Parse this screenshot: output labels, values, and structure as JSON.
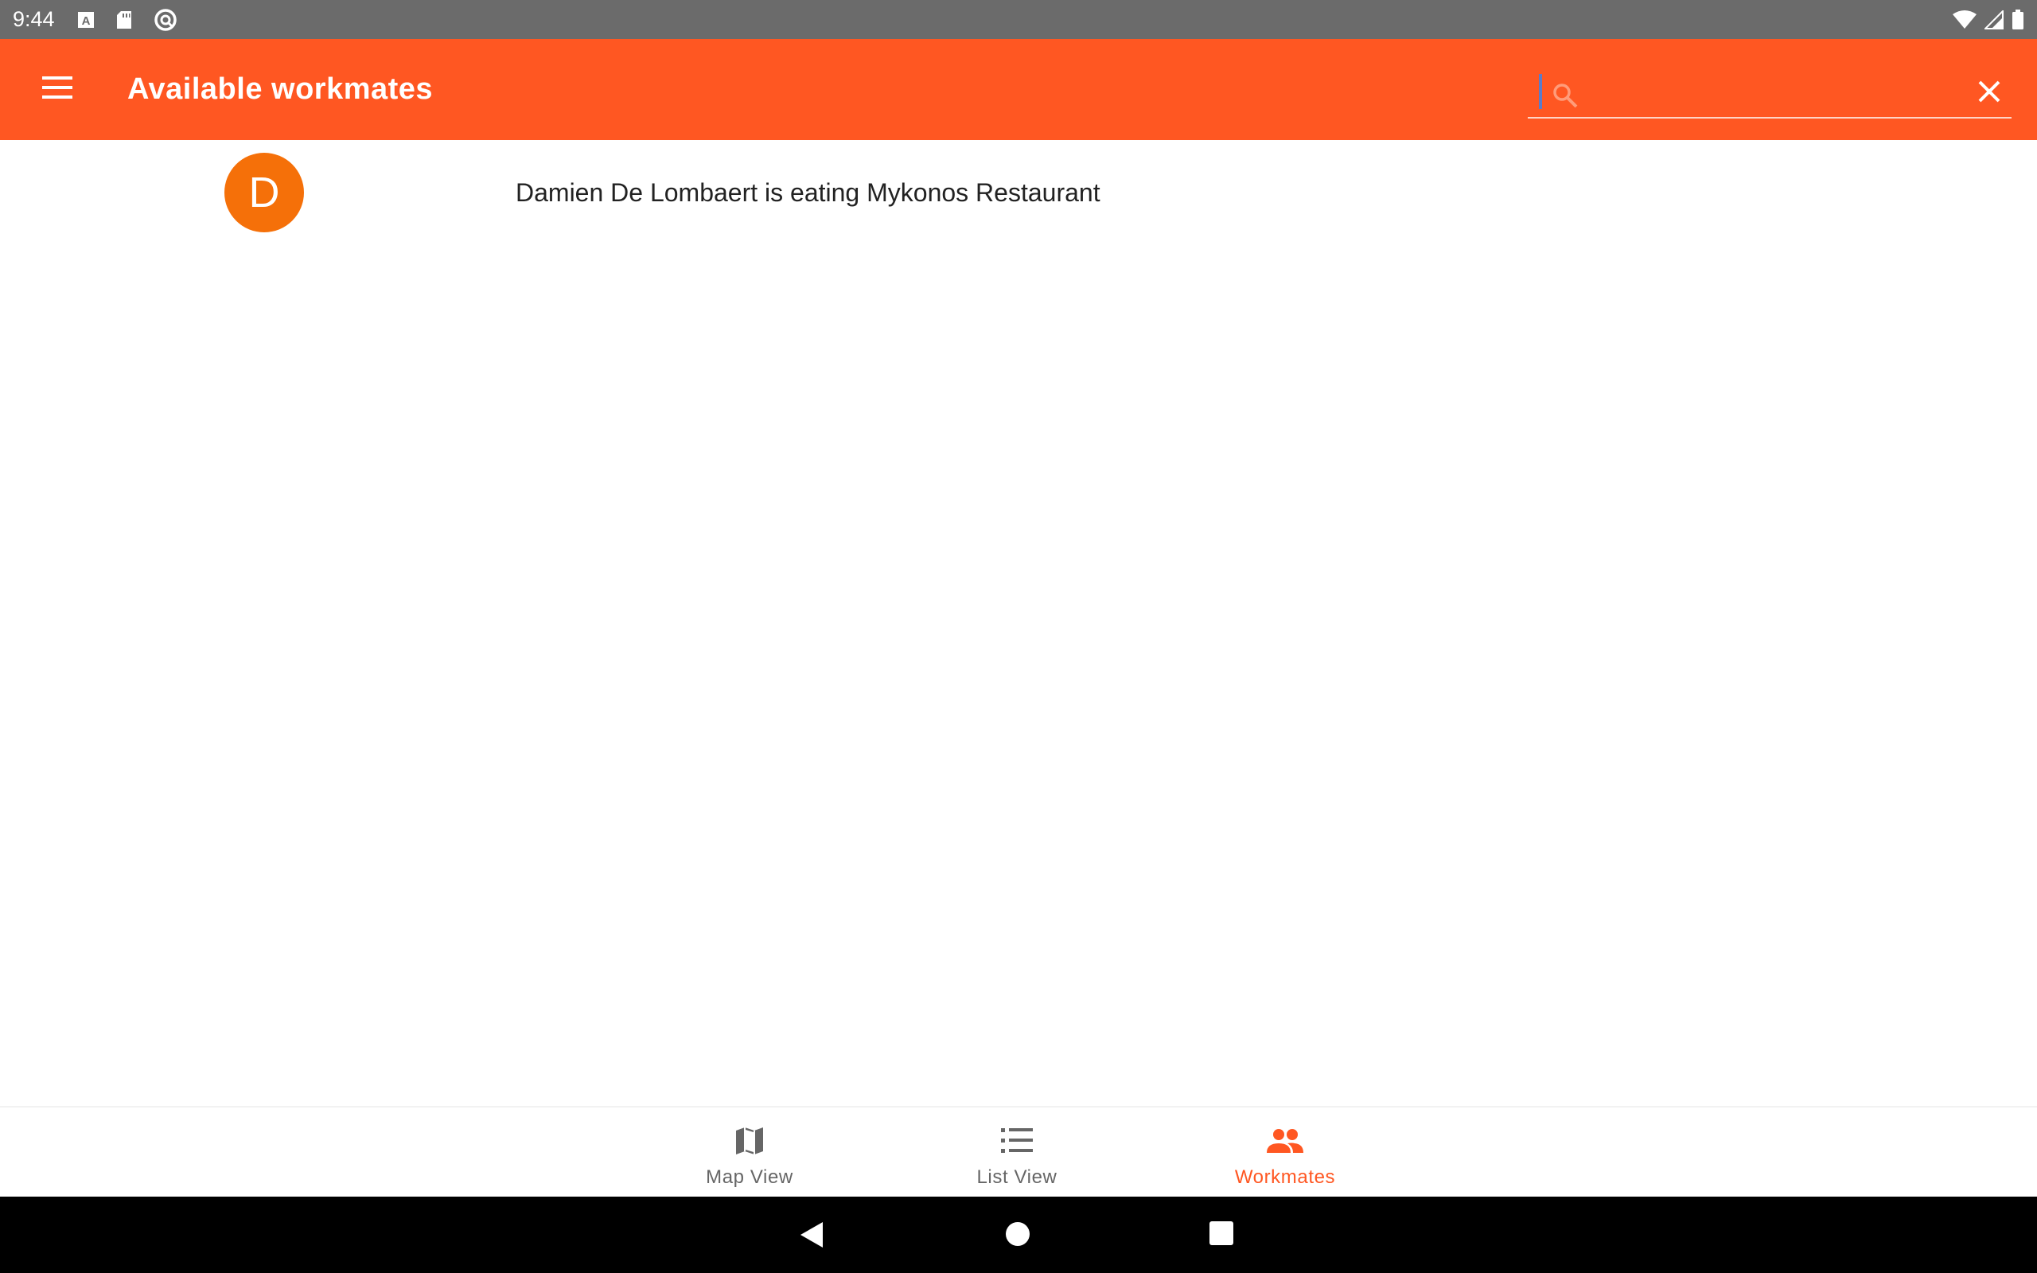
{
  "status_bar": {
    "time": "9:44",
    "left_icons": [
      "a-notification-icon",
      "sd-card-icon",
      "sync-icon"
    ],
    "right_icons": [
      "wifi-icon",
      "cell-signal-icon",
      "battery-icon"
    ]
  },
  "app_bar": {
    "title": "Available workmates",
    "menu_icon": "hamburger-menu-icon",
    "search": {
      "value": "",
      "placeholder": ""
    },
    "clear_icon": "close-icon"
  },
  "workmates": [
    {
      "initial": "D",
      "text": "Damien De Lombaert is eating Mykonos Restaurant"
    }
  ],
  "bottom_nav": {
    "items": [
      {
        "label": "Map View",
        "icon": "map-icon",
        "selected": false
      },
      {
        "label": "List View",
        "icon": "list-icon",
        "selected": false
      },
      {
        "label": "Workmates",
        "icon": "people-icon",
        "selected": true
      }
    ]
  },
  "colors": {
    "primary": "#ff5722",
    "avatar": "#f57009",
    "status_bar": "#6b6b6b",
    "nav_inactive": "#666666"
  },
  "system_nav": [
    "back-button",
    "home-button",
    "recents-button"
  ]
}
